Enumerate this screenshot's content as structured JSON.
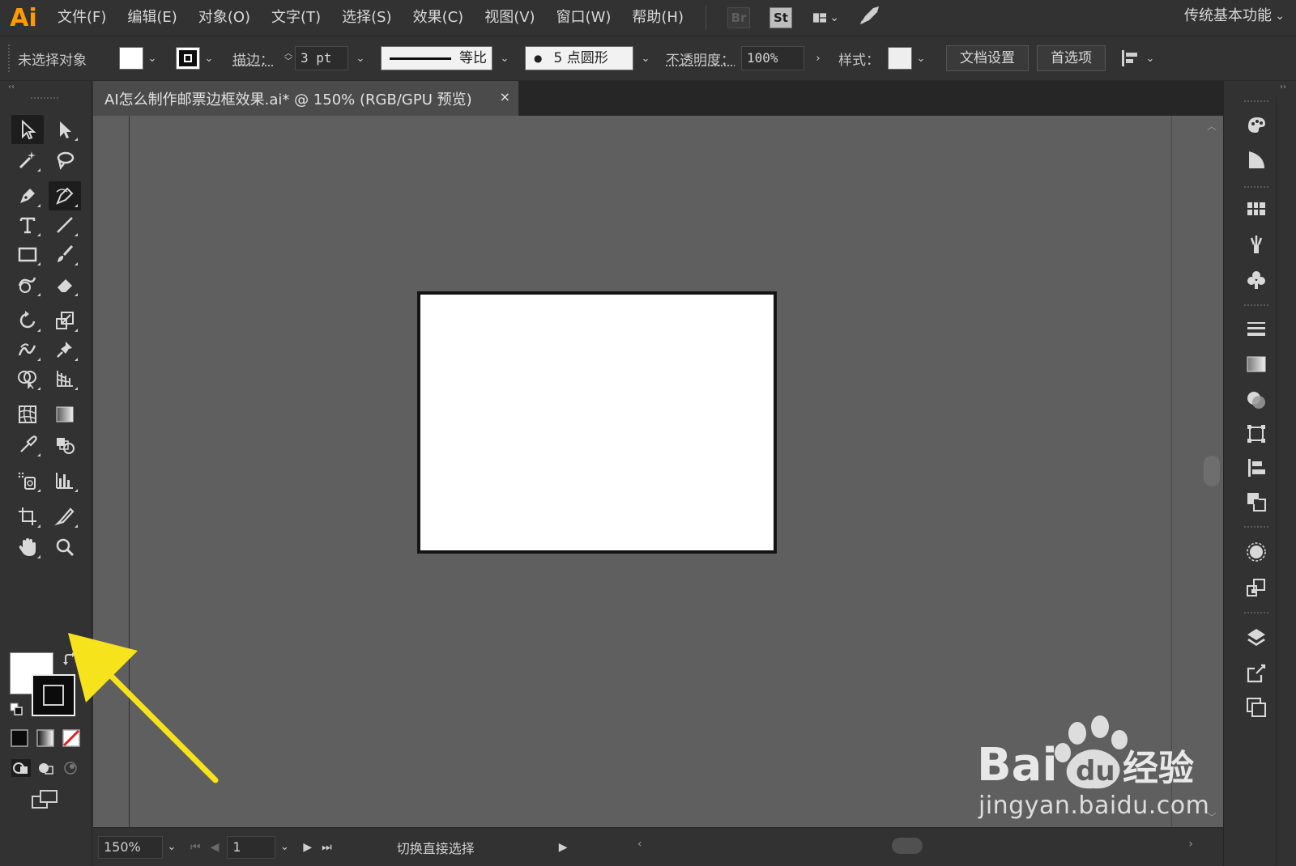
{
  "app": {
    "logo": "Ai",
    "brand_color": "#ff9a00"
  },
  "menu": {
    "items": [
      "文件(F)",
      "编辑(E)",
      "对象(O)",
      "文字(T)",
      "选择(S)",
      "效果(C)",
      "视图(V)",
      "窗口(W)",
      "帮助(H)"
    ],
    "bridge_label": "Br",
    "stock_label": "St",
    "workspace": "传统基本功能"
  },
  "control_bar": {
    "selection_status": "未选择对象",
    "stroke_label": "描边：",
    "stroke_weight": "3 pt",
    "profile_label": "等比",
    "brush_label": "5 点圆形",
    "brush_dot": "●",
    "opacity_label": "不透明度：",
    "opacity_value": "100%",
    "style_label": "样式：",
    "doc_setup_button": "文档设置",
    "preferences_button": "首选项"
  },
  "document": {
    "tab_title": "AI怎么制作邮票边框效果.ai* @ 150% (RGB/GPU 预览)",
    "close_glyph": "×"
  },
  "status_bar": {
    "zoom": "150%",
    "page": "1",
    "status_text": "切换直接选择"
  },
  "tools": [
    "selection-tool",
    "direct-selection-tool",
    "magic-wand-tool",
    "lasso-tool",
    "pen-tool",
    "curvature-tool",
    "type-tool",
    "line-segment-tool",
    "rectangle-tool",
    "paintbrush-tool",
    "shaper-tool",
    "eraser-tool",
    "rotate-tool",
    "scale-tool",
    "warp-tool",
    "puppet-warp-tool",
    "shape-builder-tool",
    "perspective-grid-tool",
    "mesh-tool",
    "gradient-tool",
    "eyedropper-tool",
    "blend-tool",
    "symbol-sprayer-tool",
    "column-graph-tool",
    "artboard-tool",
    "slice-tool",
    "hand-tool",
    "zoom-tool"
  ],
  "right_panels": [
    "color-panel-icon",
    "color-guide-icon",
    "swatches-icon",
    "brushes-icon",
    "symbols-icon",
    "stroke-panel-icon",
    "gradient-panel-icon",
    "transparency-icon",
    "transform-icon",
    "align-icon",
    "pathfinder-icon",
    "appearance-icon",
    "graphic-styles-icon",
    "layers-icon",
    "asset-export-icon",
    "artboards-panel-icon"
  ],
  "watermark": {
    "brand": "Bai",
    "brand_du": "du",
    "product": "经验",
    "url": "jingyan.baidu.com"
  },
  "colors": {
    "fill": "#ffffff",
    "stroke": "#000000",
    "annotation_arrow": "#f7e31b",
    "canvas": "#5f5f5f"
  }
}
